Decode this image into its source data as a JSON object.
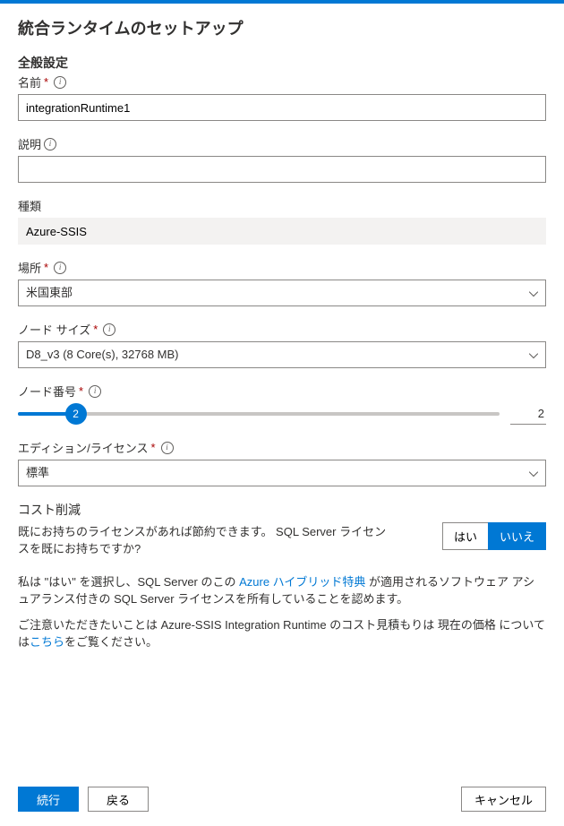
{
  "title": "統合ランタイムのセットアップ",
  "section": {
    "general": "全般設定",
    "cost": "コスト削減"
  },
  "fields": {
    "name": {
      "label": "名前",
      "value": "integrationRuntime1"
    },
    "description": {
      "label": "説明",
      "value": ""
    },
    "type": {
      "label": "種類",
      "value": "Azure-SSIS"
    },
    "location": {
      "label": "場所",
      "value": "米国東部"
    },
    "nodeSize": {
      "label": "ノード サイズ",
      "value": "D8_v3 (8 Core(s), 32768 MB)"
    },
    "nodeNumber": {
      "label": "ノード番号",
      "value": "2",
      "display": "2",
      "percent": 12
    },
    "edition": {
      "label": "エディション/ライセンス",
      "value": "標準"
    }
  },
  "cost": {
    "prompt": "既にお持ちのライセンスがあれば節約できます。 SQL Server ライセンスを既にお持ちですか?",
    "yes": "はい",
    "no": "いいえ",
    "confirm_pre": "私は \"はい\" を選択し、SQL Server のこの ",
    "confirm_link": "Azure ハイブリッド特典",
    "confirm_post": " が適用されるソフトウェア アシュアランス付きの SQL Server ライセンスを所有していることを認めます。",
    "estimate_pre": "ご注意いただきたいことは Azure-SSIS Integration Runtime のコスト見積もりは 現在の価格 については",
    "estimate_link": "こちら",
    "estimate_post": "をご覧ください。"
  },
  "footer": {
    "continue": "続行",
    "back": "戻る",
    "cancel": "キャンセル"
  }
}
